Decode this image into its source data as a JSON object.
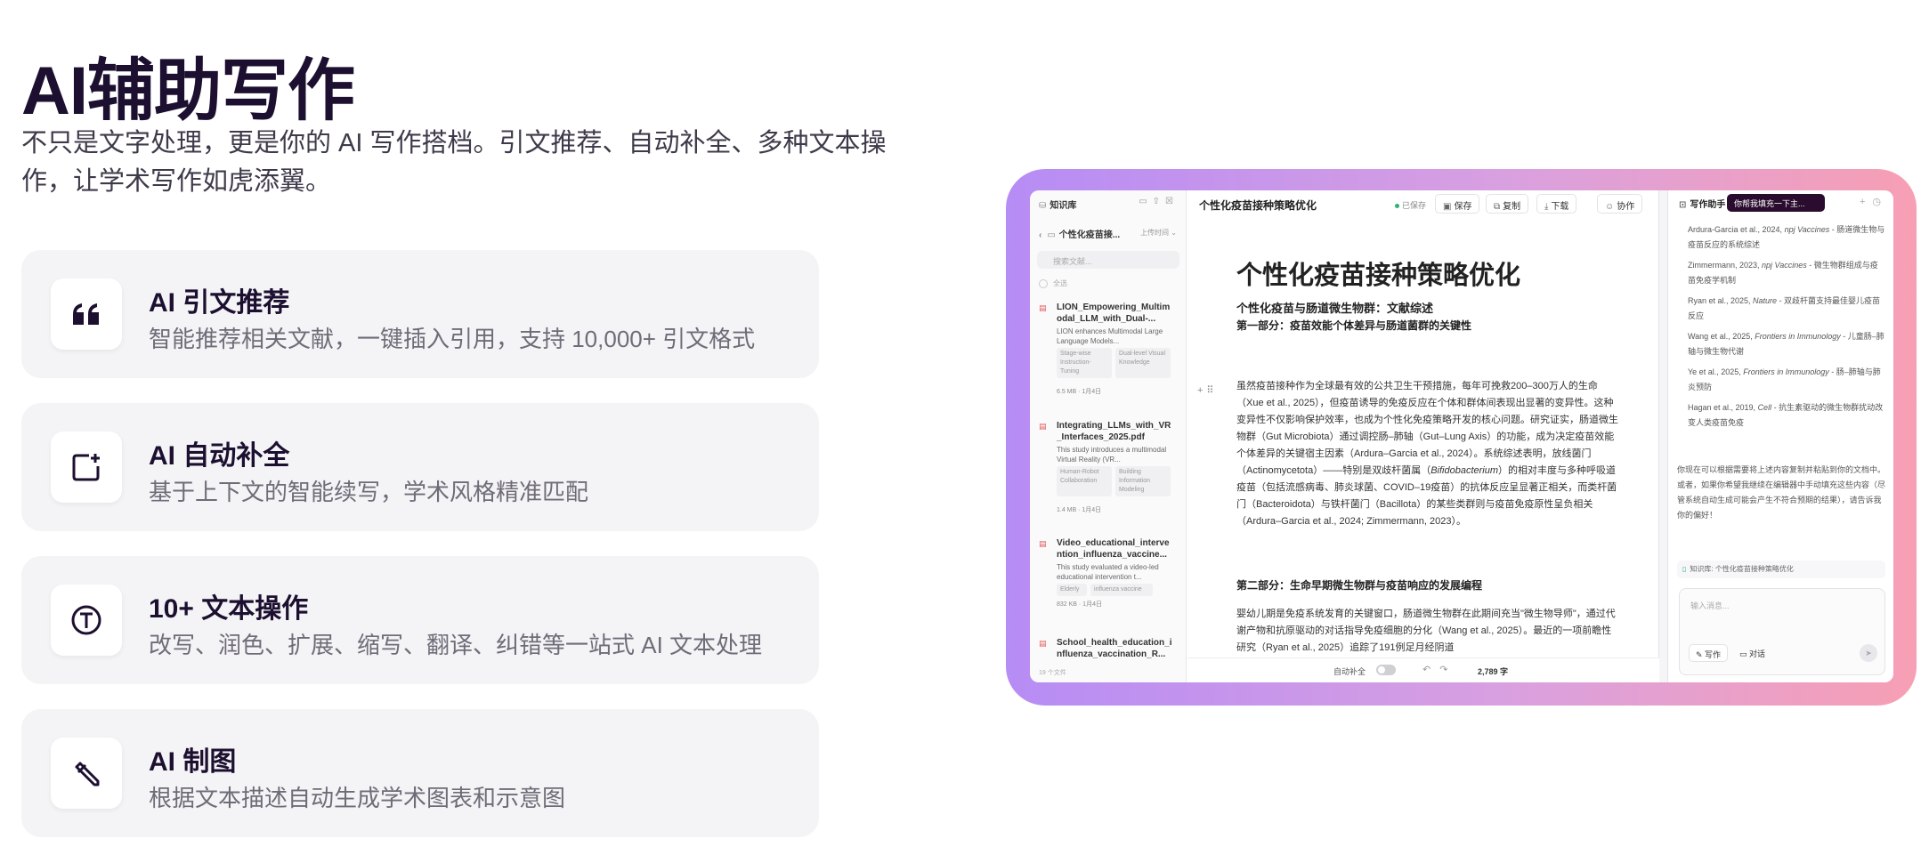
{
  "hero": {
    "title": "AI辅助写作",
    "subtitle": "不只是文字处理，更是你的 AI 写作搭档。引文推荐、自动补全、多种文本操作，让学术写作如虎添翼。"
  },
  "features": [
    {
      "icon": "quote-icon",
      "title": "AI 引文推荐",
      "desc": "智能推荐相关文献，一键插入引用，支持 10,000+ 引文格式"
    },
    {
      "icon": "add-to-page-icon",
      "title": "AI 自动补全",
      "desc": "基于上下文的智能续写，学术风格精准匹配"
    },
    {
      "icon": "text-circle-icon",
      "title": "10+ 文本操作",
      "desc": "改写、润色、扩展、缩写、翻译、纠错等一站式 AI 文本处理"
    },
    {
      "icon": "pen-icon",
      "title": "AI 制图",
      "desc": "根据文本描述自动生成学术图表和示意图"
    }
  ],
  "app": {
    "kb": {
      "header": "知识库",
      "folder": "个性化疫苗接...",
      "sort": "上传时间 ⌄",
      "search_placeholder": "搜索文献...",
      "select_all": "全选",
      "count": "19 个文件",
      "docs": [
        {
          "name": "LION_Empowering_Multimodal_LLM_with_Dual-...",
          "summary": "LION enhances Multimodal Large Language Models...",
          "tags": [
            "Stage-wise Instruction-Tuning",
            "Dual-level Visual Knowledge"
          ],
          "meta": "6.5 MB · 1月4日"
        },
        {
          "name": "Integrating_LLMs_with_VR_Interfaces_2025.pdf",
          "summary": "This study introduces a multimodal Virtual Reality (VR...",
          "tags": [
            "Human-Robot Collaboration",
            "Building Information Modeling"
          ],
          "meta": "1.4 MB · 1月4日"
        },
        {
          "name": "Video_educational_intervention_influenza_vaccine...",
          "summary": "This study evaluated a video-led educational intervention t...",
          "tags": [
            "Elderly",
            "influenza vaccine"
          ],
          "meta": "832 KB · 1月4日"
        },
        {
          "name": "School_health_education_influenza_vaccination_R...",
          "summary": "",
          "tags": [],
          "meta": ""
        }
      ]
    },
    "editor": {
      "doc_title": "个性化疫苗接种策略优化",
      "saved": "已保存",
      "buttons": {
        "save": "保存",
        "copy": "复制",
        "download": "下载",
        "collab": "协作"
      },
      "h1": "个性化疫苗接种策略优化",
      "h2": "个性化疫苗与肠道微生物群：文献综述",
      "h3a": "第一部分：疫苗效能个体差异与肠道菌群的关键性",
      "p1_a": "虽然疫苗接种作为全球最有效的公共卫生干预措施，每年可挽救200–300万人的生命（Xue et al., 2025），但疫苗诱导的免疫反应在个体和群体间表现出显著的变异性。这种变异性不仅影响保护效率，也成为个性化免疫策略开发的核心问题。研究证实，肠道微生物群（Gut Microbiota）通过调控肠–肺轴（Gut–Lung Axis）的功能，成为决定疫苗效能个体差异的关键宿主因素（Ardura–Garcia et al., 2024）。系统综述表明，放线菌门（Actinomycetota）——特别是双歧杆菌属（",
      "p1_italic": "Bifidobacterium",
      "p1_b": "）的相对丰度与多种呼吸道疫苗（包括流感病毒、肺炎球菌、COVID–19疫苗）的抗体反应呈显著正相关，而类杆菌门（Bacteroidota）与铁杆菌门（Bacillota）的某些类群则与疫苗免疫原性呈负相关（Ardura–Garcia et al., 2024; Zimmermann, 2023）。",
      "h3b": "第二部分：生命早期微生物群与疫苗响应的发展编程",
      "p2": "婴幼儿期是免疫系统发育的关键窗口，肠道微生物群在此期间充当\"微生物导师\"，通过代谢产物和抗原驱动的对话指导免疫细胞的分化（Wang et al., 2025）。最近的一项前瞻性研究（Ryan et al., 2025）追踪了191例足月经阴道",
      "autocomplete": "自动补全",
      "word_count": "2,789 字"
    },
    "assistant": {
      "header": "写作助手",
      "pill": "你帮我填充一下主...",
      "refs": [
        {
          "pre": "Ardura-Garcia et al., 2024, ",
          "journal": "npj Vaccines",
          "post": " - 肠道微生物与疫苗反应的系统综述"
        },
        {
          "pre": "Zimmermann, 2023, ",
          "journal": "npj Vaccines",
          "post": " - 微生物群组成与疫苗免疫学机制"
        },
        {
          "pre": "Ryan et al., 2025, ",
          "journal": "Nature",
          "post": " - 双歧杆菌支持最佳婴儿疫苗反应"
        },
        {
          "pre": "Wang et al., 2025, ",
          "journal": "Frontiers in Immunology",
          "post": " - 儿童肠–肺轴与微生物代谢"
        },
        {
          "pre": "Ye et al., 2025, ",
          "journal": "Frontiers in Immunology",
          "post": " - 肠–肺轴与肺炎预防"
        },
        {
          "pre": "Hagan et al., 2019, ",
          "journal": "Cell",
          "post": " - 抗生素驱动的微生物群扰动改变人类疫苗免疫"
        }
      ],
      "message": "你现在可以根据需要将上述内容复制并粘贴到你的文档中。或者，如果你希望我继续在编辑器中手动填充这些内容（尽管系统自动生成可能会产生不符合预期的结果），请告诉我你的偏好！",
      "kb_ref": "知识库: 个性化疫苗接种策略优化",
      "input_placeholder": "输入消息...",
      "mode_write": "写作",
      "mode_chat": "对话"
    }
  },
  "colors": {
    "frame_start": "#b68cf5",
    "frame_end": "#f79fb4",
    "accent_dark": "#2a0c2e"
  }
}
